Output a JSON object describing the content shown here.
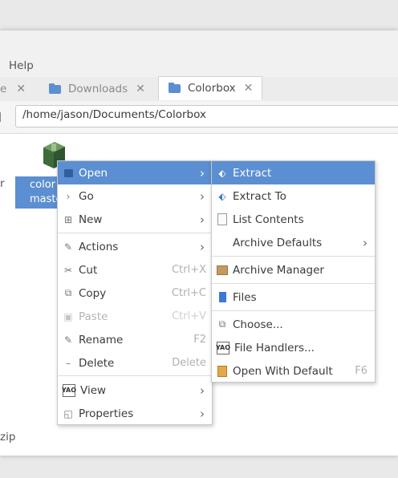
{
  "window": {
    "menubar": {
      "help": "Help"
    },
    "tabs": [
      {
        "label": "e",
        "close": "✕"
      },
      {
        "label": "Downloads",
        "close": "✕"
      },
      {
        "label": "Colorbox",
        "close": "✕"
      }
    ],
    "location": {
      "path": "/home/jason/Documents/Colorbox"
    },
    "content": {
      "left_edge_text": "r",
      "selected_file_label_line1": "color",
      "selected_file_label_line2": "maste",
      "bottom_left_text": "zip"
    }
  },
  "context_menu": {
    "items": [
      {
        "label": "Open",
        "icon": "folder-open-icon",
        "arrow": "›"
      },
      {
        "label": "Go",
        "icon": "chevron-right-icon",
        "glyph": "›",
        "arrow": "›"
      },
      {
        "label": "New",
        "icon": "plus-square-icon",
        "glyph": "⊞",
        "arrow": "›"
      },
      {
        "label": "Actions",
        "icon": "wand-icon",
        "glyph": "✎",
        "arrow": "›"
      },
      {
        "label": "Cut",
        "icon": "scissors-icon",
        "glyph": "✂",
        "accel": "Ctrl+X"
      },
      {
        "label": "Copy",
        "icon": "copy-icon",
        "glyph": "⧉",
        "accel": "Ctrl+C"
      },
      {
        "label": "Paste",
        "icon": "clipboard-icon",
        "glyph": "▣",
        "accel": "Ctrl+V"
      },
      {
        "label": "Rename",
        "icon": "pencil-icon",
        "glyph": "✎",
        "accel": "F2"
      },
      {
        "label": "Delete",
        "icon": "minus-icon",
        "glyph": "–",
        "accel": "Delete"
      },
      {
        "label": "View",
        "icon": "view-icon",
        "glyph": "YAO",
        "arrow": "›"
      },
      {
        "label": "Properties",
        "icon": "properties-icon",
        "glyph": "◱",
        "arrow": "›"
      }
    ]
  },
  "submenu": {
    "items": [
      {
        "label": "Extract",
        "icon": "extract-icon",
        "glyph": "⬖"
      },
      {
        "label": "Extract To",
        "icon": "extract-to-icon",
        "glyph": "⬖"
      },
      {
        "label": "List Contents",
        "icon": "document-icon"
      },
      {
        "label": "Archive Defaults",
        "arrow": "›"
      },
      {
        "label": "Archive Manager",
        "icon": "package-icon"
      },
      {
        "label": "Files",
        "icon": "files-icon"
      },
      {
        "label": "Choose...",
        "icon": "choose-icon",
        "glyph": "⧉"
      },
      {
        "label": "File Handlers...",
        "icon": "handlers-icon",
        "glyph": "YAO"
      },
      {
        "label": "Open With Default",
        "icon": "open-with-default-icon",
        "accel": "F6"
      }
    ]
  },
  "colors": {
    "accent": "#5b8fd1",
    "menu_border": "#c9c9c9",
    "disabled": "#b5b5b5"
  }
}
